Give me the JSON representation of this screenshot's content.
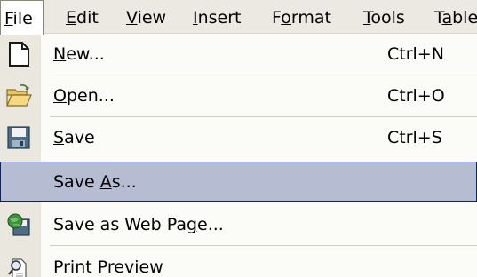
{
  "menubar": {
    "items": [
      {
        "pre": "",
        "acc": "F",
        "post": "ile"
      },
      {
        "pre": "",
        "acc": "E",
        "post": "dit"
      },
      {
        "pre": "",
        "acc": "V",
        "post": "iew"
      },
      {
        "pre": "",
        "acc": "I",
        "post": "nsert"
      },
      {
        "pre": "F",
        "acc": "o",
        "post": "rmat"
      },
      {
        "pre": "",
        "acc": "T",
        "post": "ools"
      },
      {
        "pre": "T",
        "acc": "a",
        "post": "ble"
      }
    ]
  },
  "file_menu": {
    "items": [
      {
        "pre": "",
        "acc": "N",
        "post": "ew...",
        "shortcut": "Ctrl+N",
        "icon": "new-document-icon"
      },
      {
        "pre": "",
        "acc": "O",
        "post": "pen...",
        "shortcut": "Ctrl+O",
        "icon": "open-folder-icon"
      },
      {
        "pre": "",
        "acc": "S",
        "post": "ave",
        "shortcut": "Ctrl+S",
        "icon": "save-floppy-icon"
      },
      {
        "pre": "Save ",
        "acc": "A",
        "post": "s...",
        "shortcut": "",
        "icon": ""
      },
      {
        "pre": "Save as Web Pa",
        "acc": "g",
        "post": "e...",
        "shortcut": "",
        "icon": "save-web-page-icon"
      },
      {
        "pre": "Print Preview",
        "acc": "",
        "post": "",
        "shortcut": "",
        "icon": "print-preview-icon"
      }
    ]
  },
  "colors": {
    "menubar_bg": "#ebe9e1",
    "icon_strip_bg": "#e9e7de",
    "highlight_bg": "#b6bdd2",
    "highlight_border": "#0a246a"
  }
}
